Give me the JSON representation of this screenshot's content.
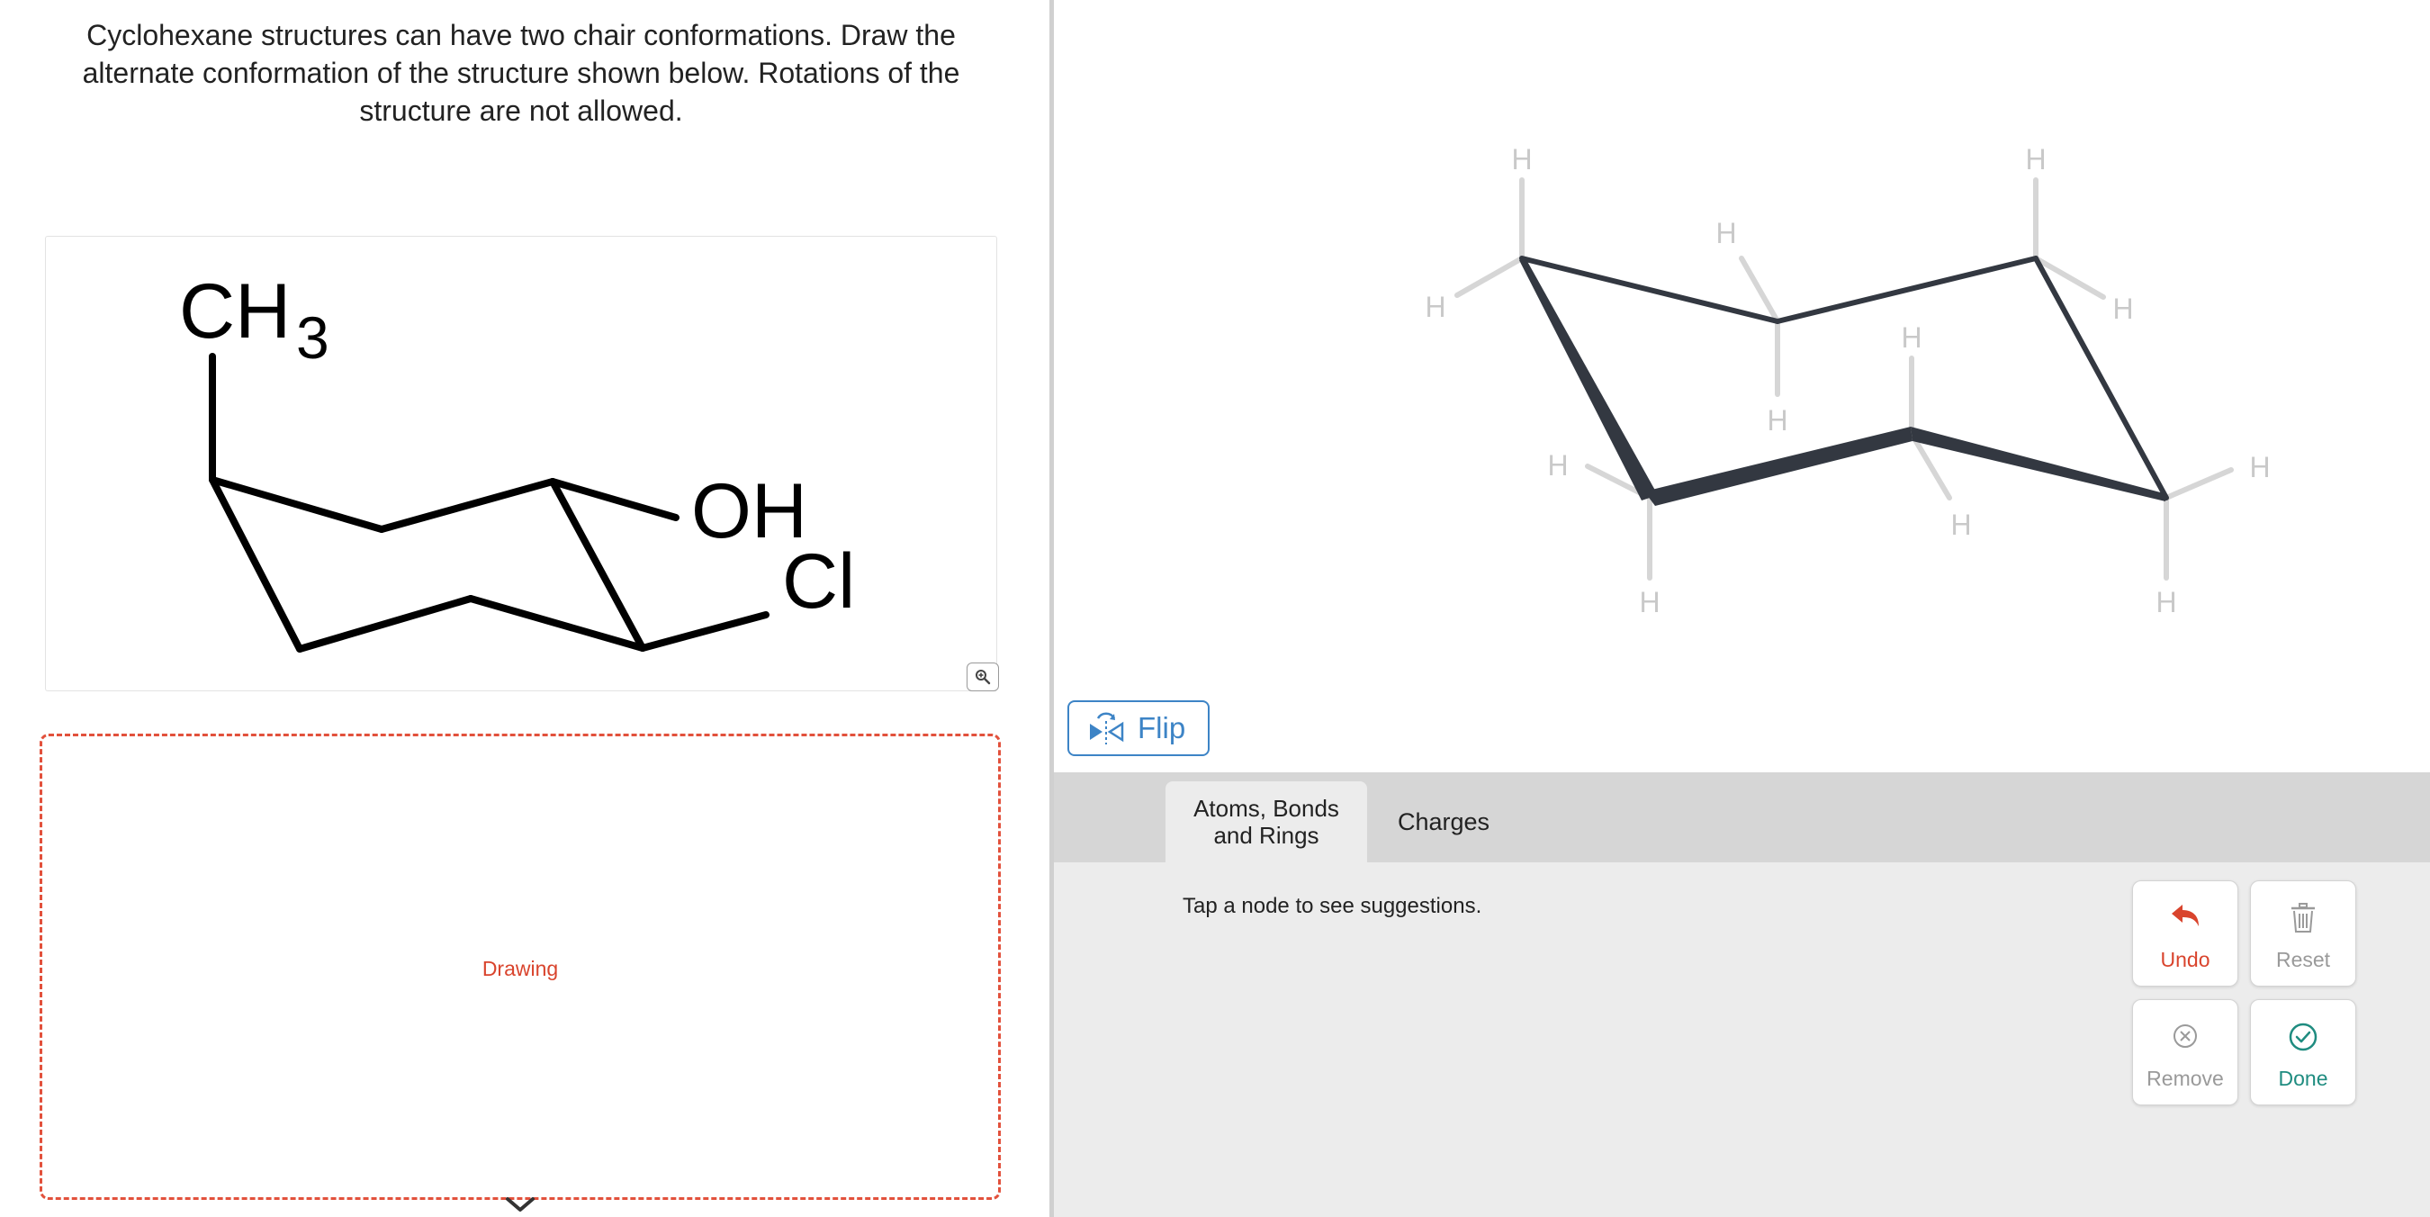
{
  "question": {
    "text": "Cyclohexane structures can have two chair conformations.  Draw the\nalternate conformation of the structure shown below. Rotations of the\nstructure are not allowed."
  },
  "given_structure": {
    "labels": {
      "ch3": "CH",
      "ch3_sub": "3",
      "oh": "OH",
      "cl": "Cl"
    },
    "zoom_icon": "magnifier-plus-icon"
  },
  "drawing": {
    "label": "Drawing",
    "expand_icon": "chevron-down-icon"
  },
  "canvas": {
    "hydrogen_label": "H",
    "hydrogen_count": 12
  },
  "flip": {
    "label": "Flip",
    "icon": "flip-icon"
  },
  "tabs": [
    {
      "label": "Atoms, Bonds\nand Rings",
      "active": true
    },
    {
      "label": "Charges",
      "active": false
    }
  ],
  "hint": "Tap a node to see suggestions.",
  "actions": {
    "undo": {
      "label": "Undo",
      "color": "#d9442d",
      "icon": "undo-icon"
    },
    "reset": {
      "label": "Reset",
      "color": "#9a9a9a",
      "icon": "trash-icon"
    },
    "remove": {
      "label": "Remove",
      "color": "#9a9a9a",
      "icon": "remove-x-icon"
    },
    "done": {
      "label": "Done",
      "color": "#1f8c80",
      "icon": "check-circle-icon"
    }
  },
  "colors": {
    "accent_red": "#e2513c",
    "link_blue": "#3d84c6",
    "bond_dark": "#333841",
    "hydrogen_gray": "#d6d6d6"
  }
}
